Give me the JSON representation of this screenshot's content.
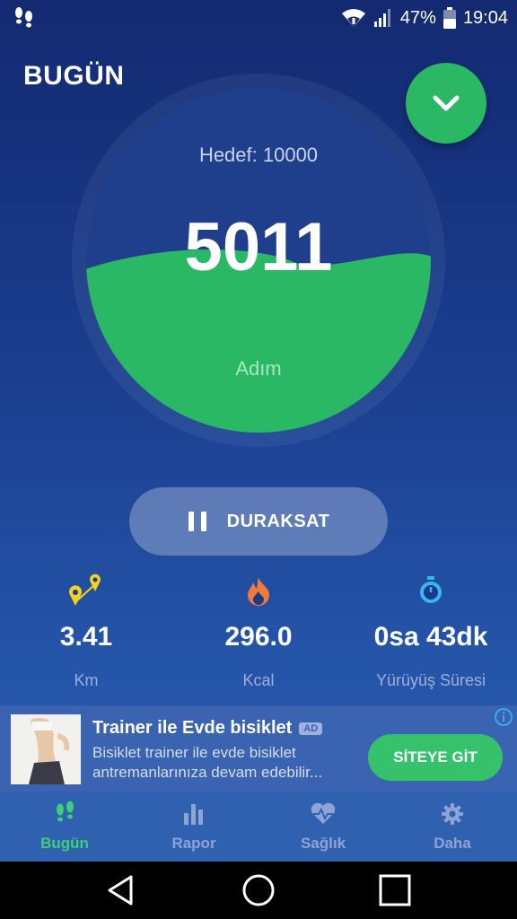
{
  "status_bar": {
    "battery": "47%",
    "time": "19:04",
    "icons": [
      "app-steps-icon",
      "wifi-icon",
      "signal-icon",
      "battery-icon"
    ]
  },
  "header": {
    "title": "BUGÜN",
    "fab_icon": "chevron-down-icon"
  },
  "gauge": {
    "goal": "Hedef: 10000",
    "steps": "5011",
    "unit": "Adım",
    "progress": 0.5011,
    "fill_color": "#2bb864"
  },
  "pause_button": {
    "label": "DURAKSAT",
    "icon": "pause-icon"
  },
  "stats": [
    {
      "icon": "route-pins-icon",
      "value": "3.41",
      "label": "Km",
      "color": "#f2d31b"
    },
    {
      "icon": "flame-icon",
      "value": "296.0",
      "label": "Kcal",
      "color": "#f07a3a"
    },
    {
      "icon": "stopwatch-icon",
      "value": "0sa 43dk",
      "label": "Yürüyüş Süresi",
      "color": "#38b6f0"
    }
  ],
  "ad": {
    "title": "Trainer ile Evde bisiklet",
    "badge": "AD",
    "description_line1": "Bisiklet trainer ile evde bisiklet",
    "description_line2": "antremanlarınıza devam edebilir...",
    "cta": "SİTEYE GİT"
  },
  "nav": {
    "items": [
      {
        "label": "Bugün",
        "icon": "footsteps-icon",
        "active": true
      },
      {
        "label": "Rapor",
        "icon": "bar-chart-icon",
        "active": false
      },
      {
        "label": "Sağlık",
        "icon": "heart-pulse-icon",
        "active": false
      },
      {
        "label": "Daha",
        "icon": "gear-icon",
        "active": false
      }
    ]
  },
  "colors": {
    "accent": "#2bb864",
    "background_top": "#132a72",
    "background_bottom": "#2c5fb2"
  }
}
